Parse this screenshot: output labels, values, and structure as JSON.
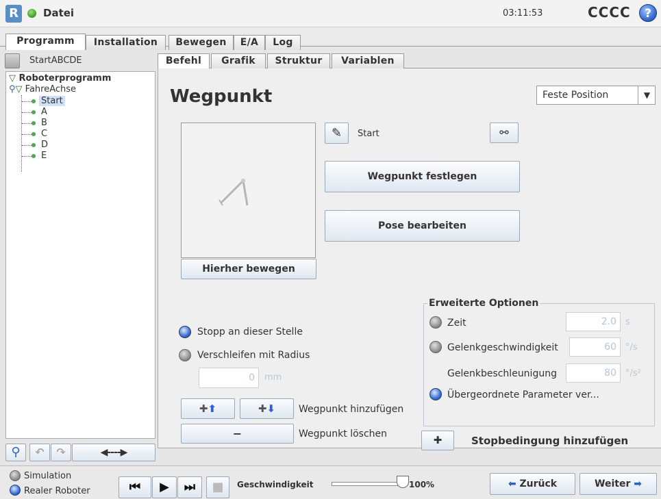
{
  "header": {
    "app_menu": "Datei",
    "clock": "03:11:53",
    "robot_name": "CCCC",
    "help_icon": "question-icon"
  },
  "main_tabs": [
    "Programm",
    "Installation",
    "Bewegen",
    "E/A",
    "Log"
  ],
  "program": {
    "save_name": "StartABCDE"
  },
  "sub_tabs": [
    "Befehl",
    "Grafik",
    "Struktur",
    "Variablen"
  ],
  "tree": {
    "root": "Roboterprogramm",
    "folder": "FahreAchse",
    "items": [
      "Start",
      "A",
      "B",
      "C",
      "D",
      "E"
    ],
    "selected": "Start"
  },
  "waypoint": {
    "title": "Wegpunkt",
    "mode": "Feste Position",
    "name": "Start",
    "set_button": "Wegpunkt festlegen",
    "edit_pose_button": "Pose bearbeiten",
    "move_here_button": "Hierher bewegen"
  },
  "motion": {
    "stop_label": "Stopp an dieser Stelle",
    "blend_label": "Verschleifen mit Radius",
    "blend_value": "0",
    "blend_unit": "mm",
    "add_label": "Wegpunkt hinzufügen",
    "delete_label": "Wegpunkt löschen"
  },
  "advanced": {
    "title": "Erweiterte Optionen",
    "time_label": "Zeit",
    "time_value": "2.0",
    "time_unit": "s",
    "speed_label": "Gelenkgeschwindigkeit",
    "speed_value": "60",
    "speed_unit": "°/s",
    "accel_label": "Gelenkbeschleunigung",
    "accel_value": "80",
    "accel_unit": "°/s²",
    "parent_label": "Übergeordnete Parameter ver..."
  },
  "stop_condition": "Stopbedingung hinzufügen",
  "footer": {
    "simulation": "Simulation",
    "real_robot": "Realer Roboter",
    "speed_label": "Geschwindigkeit",
    "speed_value": "100%",
    "speed_fraction": 1.0,
    "back": "Zurück",
    "next": "Weiter"
  }
}
